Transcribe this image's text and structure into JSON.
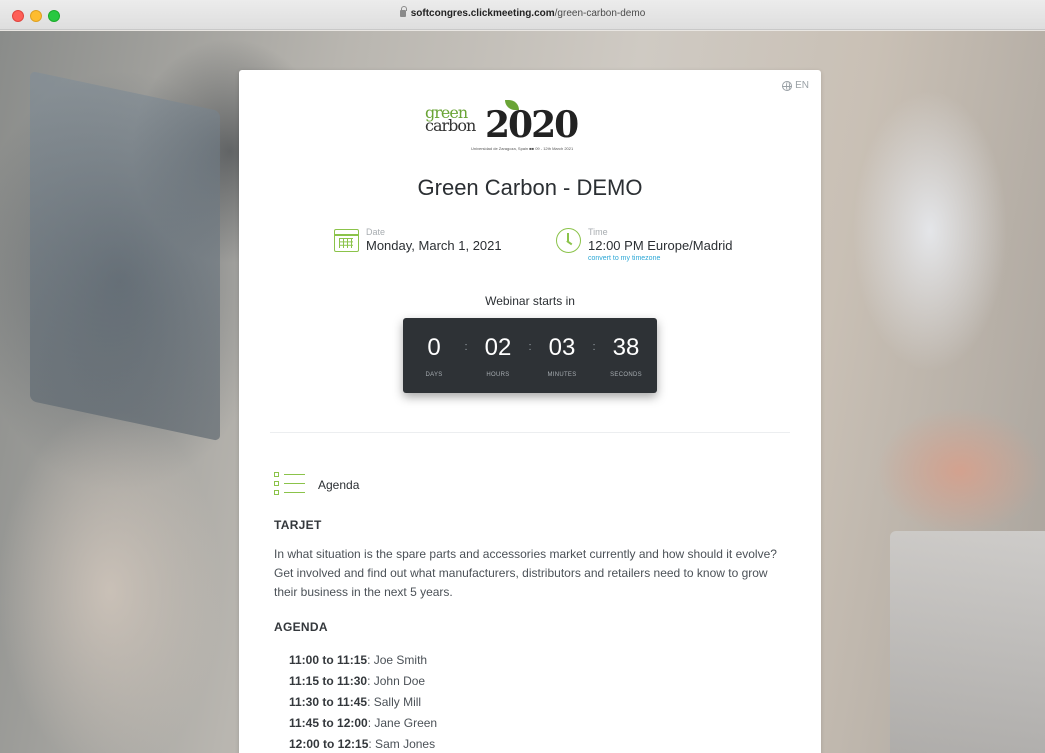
{
  "browser": {
    "url_host": "softcongres.clickmeeting.com",
    "url_path": "/green-carbon-demo"
  },
  "colors": {
    "accent_green": "#8bc34a",
    "link_blue": "#2aa6d5",
    "countdown_bg": "#2e3236"
  },
  "card": {
    "lang": "EN",
    "logo": {
      "line1": "green",
      "line2": "carbon",
      "year": "2020",
      "tagline": "Universidad de Zaragoza, Spain ■■ 09 - 12th March 2021"
    },
    "title": "Green Carbon - DEMO",
    "date": {
      "label": "Date",
      "value": "Monday, March 1, 2021",
      "icon": "calendar-icon"
    },
    "time": {
      "label": "Time",
      "value": "12:00 PM Europe/Madrid",
      "link": "convert to my timezone",
      "icon": "clock-icon"
    },
    "starts_label": "Webinar starts in",
    "countdown": {
      "days": "0",
      "hours": "02",
      "minutes": "03",
      "seconds": "38",
      "days_label": "DAYS",
      "hours_label": "HOURS",
      "minutes_label": "MINUTES",
      "seconds_label": "SECONDS",
      "separator": ":"
    },
    "agenda": {
      "icon": "list-icon",
      "label": "Agenda",
      "section1_title": "TARJET",
      "description": "In what situation is the spare parts and accessories market currently and how should it evolve? Get involved and find out what manufacturers, distributors and retailers need to know to grow their business in the next 5 years.",
      "section2_title": "AGENDA",
      "items": [
        {
          "time": "11:00 to 11:15",
          "name": ": Joe Smith"
        },
        {
          "time": "11:15 to 11:30",
          "name": ": John Doe"
        },
        {
          "time": "11:30 to 11:45",
          "name": ": Sally Mill"
        },
        {
          "time": "11:45 to 12:00",
          "name": ": Jane Green"
        },
        {
          "time": "12:00 to 12:15",
          "name": ": Sam Jones"
        }
      ]
    }
  }
}
